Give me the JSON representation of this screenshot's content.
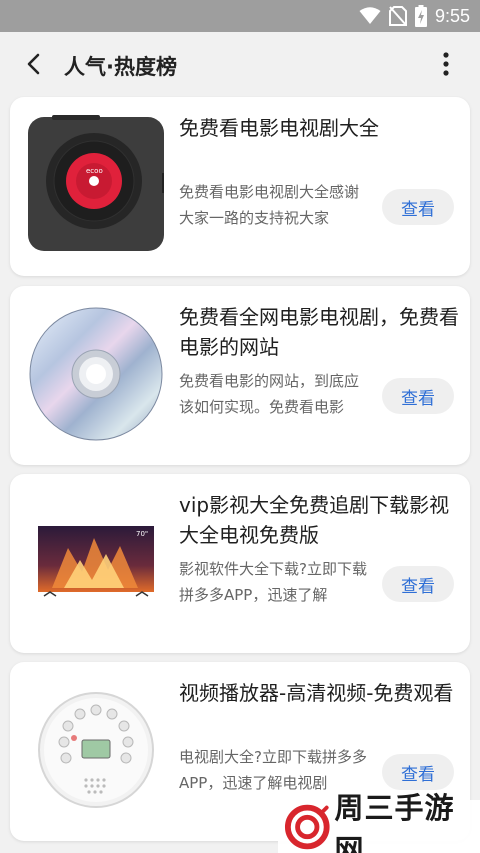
{
  "status_bar": {
    "time": "9:55",
    "icons": [
      "wifi-icon",
      "no-sim-icon",
      "battery-charging-icon"
    ]
  },
  "app_bar": {
    "title": "人气·热度榜",
    "back_icon": "arrow-back-icon",
    "menu_icon": "more-vert-icon"
  },
  "list": [
    {
      "title": "免费看电影电视剧大全",
      "description": "免费看电影电视剧大全感谢大家一路的支持祝大家",
      "button": "查看",
      "thumb": "cd-player-image"
    },
    {
      "title": "免费看全网电影电视剧，免费看电影的网站",
      "description": "免费看电影的网站，到底应该如何实现。免费看电影",
      "button": "查看",
      "thumb": "cd-disc-image"
    },
    {
      "title": "vip影视大全免费追剧下载影视大全电视免费版",
      "description": "影视软件大全下载?立即下载拼多多APP，迅速了解",
      "button": "查看",
      "thumb": "television-image"
    },
    {
      "title": "视频播放器-高清视频-免费观看",
      "description": "电视剧大全?立即下载拼多多APP，迅速了解电视剧",
      "button": "查看",
      "thumb": "portable-cd-player-image"
    }
  ],
  "watermark": {
    "text": "周三手游网",
    "logo_color": "#d8262d"
  },
  "colors": {
    "accent": "#2f6fd6",
    "status_bar": "#9e9e9e",
    "background": "#f1f1f1"
  }
}
